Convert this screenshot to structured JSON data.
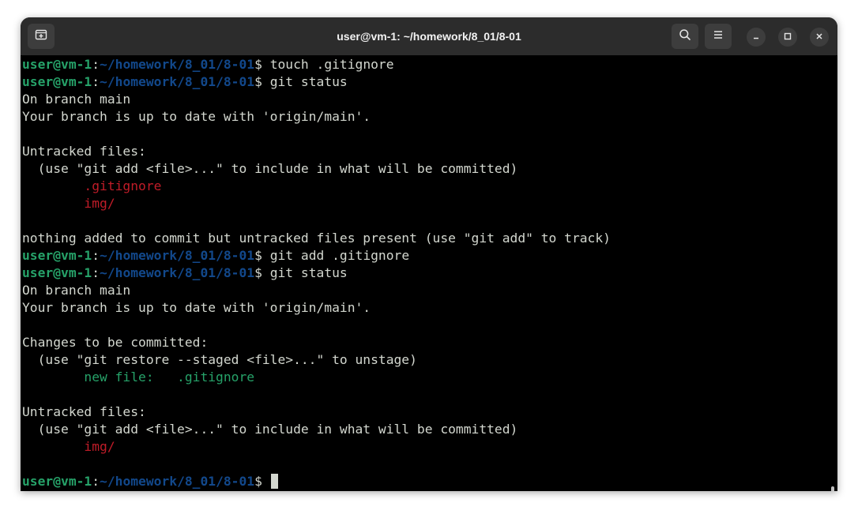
{
  "window": {
    "title": "user@vm-1: ~/homework/8_01/8-01",
    "header_buttons": {
      "new_tab_icon": "new-tab-icon",
      "search_icon": "search-icon",
      "menu_icon": "hamburger-menu-icon",
      "minimize_icon": "minimize-icon",
      "maximize_icon": "maximize-icon",
      "close_icon": "close-icon"
    }
  },
  "terminal": {
    "prompt": {
      "user": "user@vm-1",
      "sep": ":",
      "path": "~/homework/8_01/8-01",
      "dollar": "$ "
    },
    "lines": [
      {
        "type": "cmd",
        "text": "touch .gitignore"
      },
      {
        "type": "cmd",
        "text": "git status"
      },
      {
        "type": "out",
        "text": "On branch main"
      },
      {
        "type": "out",
        "text": "Your branch is up to date with 'origin/main'."
      },
      {
        "type": "out",
        "text": ""
      },
      {
        "type": "out",
        "text": "Untracked files:"
      },
      {
        "type": "out",
        "text": "  (use \"git add <file>...\" to include in what will be committed)"
      },
      {
        "type": "red",
        "text": "        .gitignore"
      },
      {
        "type": "red",
        "text": "        img/"
      },
      {
        "type": "out",
        "text": ""
      },
      {
        "type": "out",
        "text": "nothing added to commit but untracked files present (use \"git add\" to track)"
      },
      {
        "type": "cmd",
        "text": "git add .gitignore"
      },
      {
        "type": "cmd",
        "text": "git status"
      },
      {
        "type": "out",
        "text": "On branch main"
      },
      {
        "type": "out",
        "text": "Your branch is up to date with 'origin/main'."
      },
      {
        "type": "out",
        "text": ""
      },
      {
        "type": "out",
        "text": "Changes to be committed:"
      },
      {
        "type": "out",
        "text": "  (use \"git restore --staged <file>...\" to unstage)"
      },
      {
        "type": "green",
        "text": "        new file:   .gitignore"
      },
      {
        "type": "out",
        "text": ""
      },
      {
        "type": "out",
        "text": "Untracked files:"
      },
      {
        "type": "out",
        "text": "  (use \"git add <file>...\" to include in what will be committed)"
      },
      {
        "type": "red",
        "text": "        img/"
      },
      {
        "type": "out",
        "text": ""
      },
      {
        "type": "cursor",
        "text": ""
      }
    ]
  },
  "colors": {
    "background": "#000000",
    "titlebar": "#2c2c2c",
    "foreground": "#d3d7cf",
    "prompt_user": "#26a269",
    "prompt_path": "#12488b",
    "untracked": "#c01c28",
    "staged": "#26a269"
  }
}
